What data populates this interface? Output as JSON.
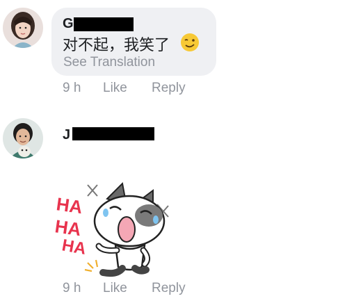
{
  "comments": [
    {
      "author_initial": "G",
      "text": "对不起，我笑了",
      "see_translation": "See Translation",
      "time": "9 h",
      "like": "Like",
      "reply": "Reply"
    },
    {
      "author_initial": "J",
      "sticker_text": [
        "HA",
        "HA",
        "HA"
      ],
      "time": "9 h",
      "like": "Like",
      "reply": "Reply"
    }
  ],
  "colors": {
    "bubble": "#eff0f3",
    "meta_text": "#90949c",
    "name_text": "#1c1e21",
    "sticker_red": "#e8344e"
  }
}
